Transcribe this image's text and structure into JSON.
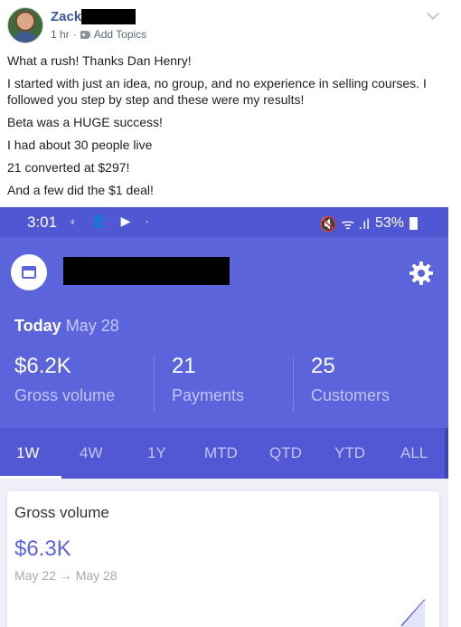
{
  "post": {
    "author": "Zack",
    "time": "1 hr",
    "separator": "·",
    "add_topics": "Add Topics",
    "lines": [
      "What a rush! Thanks Dan Henry!",
      "I started with just an idea, no group, and no experience in selling courses. I followed you step by step and these were my results!",
      "Beta was a HUGE success!",
      "I had about 30 people live",
      "21 converted at $297!",
      "And a few did the $1 deal!"
    ]
  },
  "phone": {
    "status": {
      "time": "3:01",
      "left_icons": "⍖ 👤 ▶ ·",
      "right_icons": "🔇 ᯤ .ıl",
      "battery": "53%"
    },
    "today_label": "Today",
    "today_date": "May 28",
    "stats": [
      {
        "value": "$6.2K",
        "label": "Gross volume"
      },
      {
        "value": "21",
        "label": "Payments"
      },
      {
        "value": "25",
        "label": "Customers"
      }
    ],
    "range_tabs": [
      "1W",
      "4W",
      "1Y",
      "MTD",
      "QTD",
      "YTD",
      "ALL"
    ],
    "active_tab": "1W",
    "card": {
      "title": "Gross volume",
      "value": "$6.3K",
      "range": "May 22 → May 28"
    }
  },
  "colors": {
    "brand": "#5c64dc",
    "facebook_link": "#385898"
  }
}
